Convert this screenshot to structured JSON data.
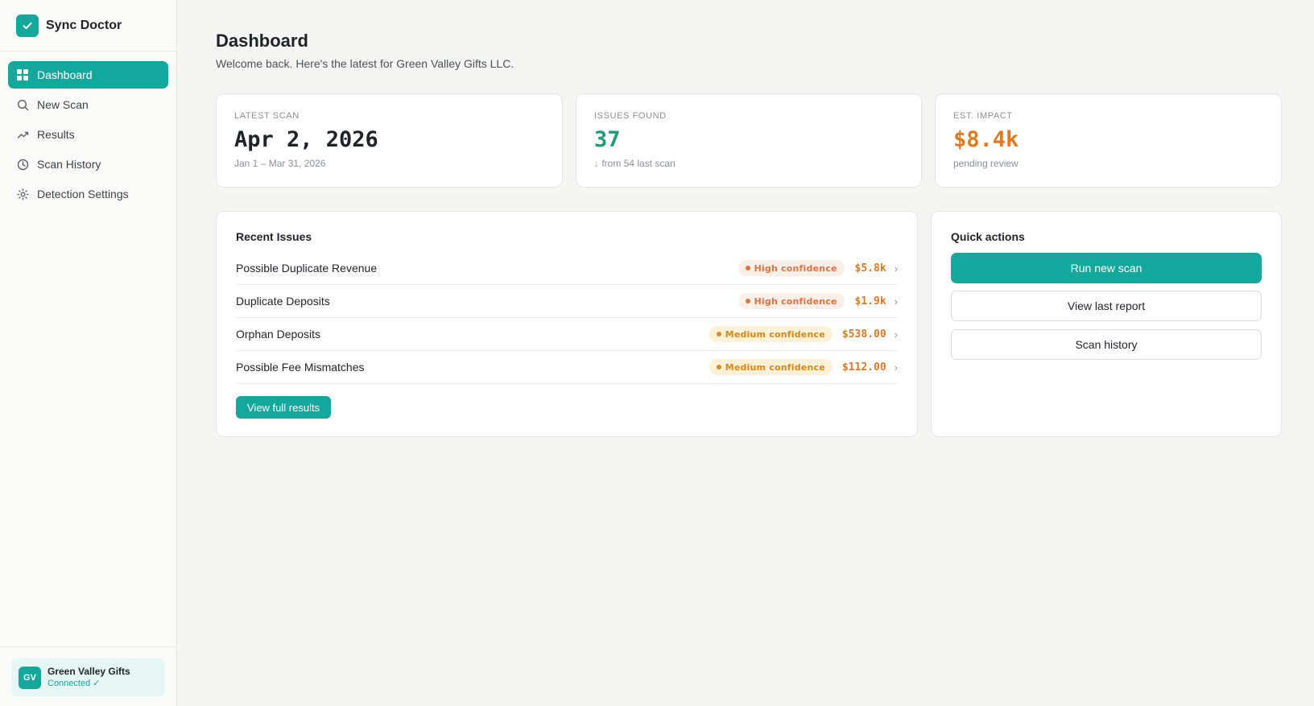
{
  "app": {
    "name": "Sync Doctor"
  },
  "sidebar": {
    "items": [
      {
        "label": "Dashboard",
        "icon": "grid-icon",
        "active": true
      },
      {
        "label": "New Scan",
        "icon": "search-icon"
      },
      {
        "label": "Results",
        "icon": "trend-icon"
      },
      {
        "label": "Scan History",
        "icon": "clock-icon"
      },
      {
        "label": "Detection Settings",
        "icon": "gear-icon"
      }
    ],
    "account": {
      "initials": "GV",
      "name": "Green Valley Gifts",
      "status": "Connected ✓"
    }
  },
  "header": {
    "title": "Dashboard",
    "subtitle": "Welcome back. Here's the latest for Green Valley Gifts LLC."
  },
  "stats": [
    {
      "label": "LATEST SCAN",
      "value": "Apr 2, 2026",
      "note": "Jan 1 – Mar 31, 2026",
      "color": "#1f2328"
    },
    {
      "label": "ISSUES FOUND",
      "value": "37",
      "note": "↓ from 54 last scan",
      "color": "#1f9e74"
    },
    {
      "label": "EST. IMPACT",
      "value": "$8.4k",
      "note": "pending review",
      "color": "#e0791e"
    }
  ],
  "recent_issues": {
    "title": "Recent Issues",
    "items": [
      {
        "name": "Possible Duplicate Revenue",
        "confidence": "High confidence",
        "level": "high",
        "amount": "$5.8k"
      },
      {
        "name": "Duplicate Deposits",
        "confidence": "High confidence",
        "level": "high",
        "amount": "$1.9k"
      },
      {
        "name": "Orphan Deposits",
        "confidence": "Medium confidence",
        "level": "medium",
        "amount": "$538.00"
      },
      {
        "name": "Possible Fee Mismatches",
        "confidence": "Medium confidence",
        "level": "medium",
        "amount": "$112.00"
      }
    ],
    "view_all_label": "View full results"
  },
  "quick_actions": {
    "title": "Quick actions",
    "run_scan_label": "Run new scan",
    "view_report_label": "View last report",
    "history_label": "Scan history"
  },
  "colors": {
    "accent": "#14a79b",
    "high": "#e0723c",
    "medium": "#d9861a",
    "amount": "#e0791e"
  }
}
